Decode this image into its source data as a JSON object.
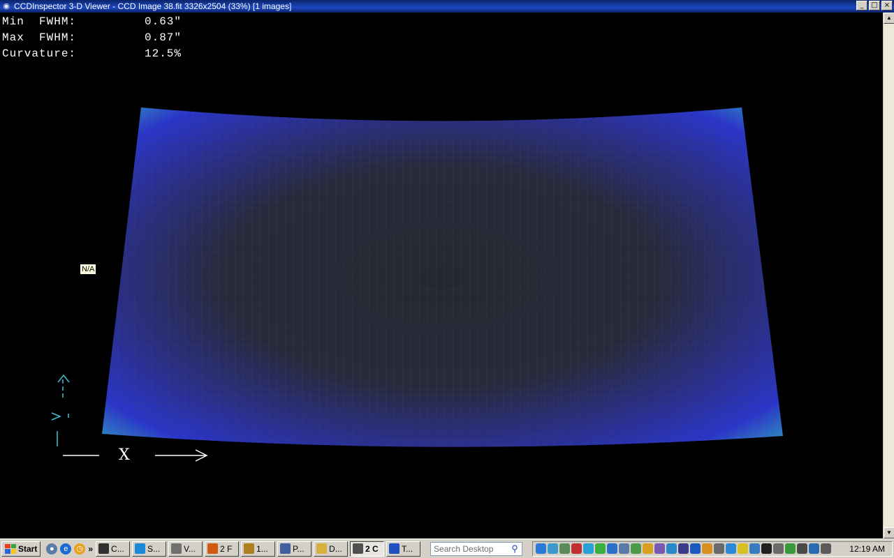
{
  "window": {
    "title": "CCDInspector 3-D Viewer - CCD Image 38.fit 3326x2504 (33%)  [1 images]",
    "controls": [
      "_",
      "□",
      "×"
    ]
  },
  "stats": [
    {
      "label": "Min  FWHM:",
      "value": "0.63\""
    },
    {
      "label": "Max  FWHM:",
      "value": "0.87\""
    },
    {
      "label": "Curvature:",
      "value": "12.5%"
    }
  ],
  "tooltip": "N/A",
  "axes": {
    "x_label": "X"
  },
  "colors": {
    "surface_center": "#262830",
    "surface_edge": "#2a33c8",
    "surface_corner": "#30b0c0",
    "axis": "#40c0d0"
  },
  "taskbar": {
    "start_label": "Start",
    "tasks": [
      {
        "label": "C...",
        "icon": "console-icon",
        "color": "#303030"
      },
      {
        "label": "S...",
        "icon": "skype-icon",
        "color": "#1a8ad8"
      },
      {
        "label": "V...",
        "icon": "document-icon",
        "color": "#707070"
      },
      {
        "label": "2 F",
        "icon": "firefox-icon",
        "color": "#d05a10"
      },
      {
        "label": "1...",
        "icon": "tool-icon",
        "color": "#b08020"
      },
      {
        "label": "P...",
        "icon": "image-icon",
        "color": "#4060a0"
      },
      {
        "label": "D...",
        "icon": "folder-icon",
        "color": "#d8b040"
      },
      {
        "label": "2 C",
        "icon": "telescope-icon",
        "color": "#505050",
        "active": true
      },
      {
        "label": "T...",
        "icon": "network-icon",
        "color": "#2050c0"
      }
    ],
    "search_placeholder": "Search Desktop",
    "clock": "12:19 AM"
  }
}
